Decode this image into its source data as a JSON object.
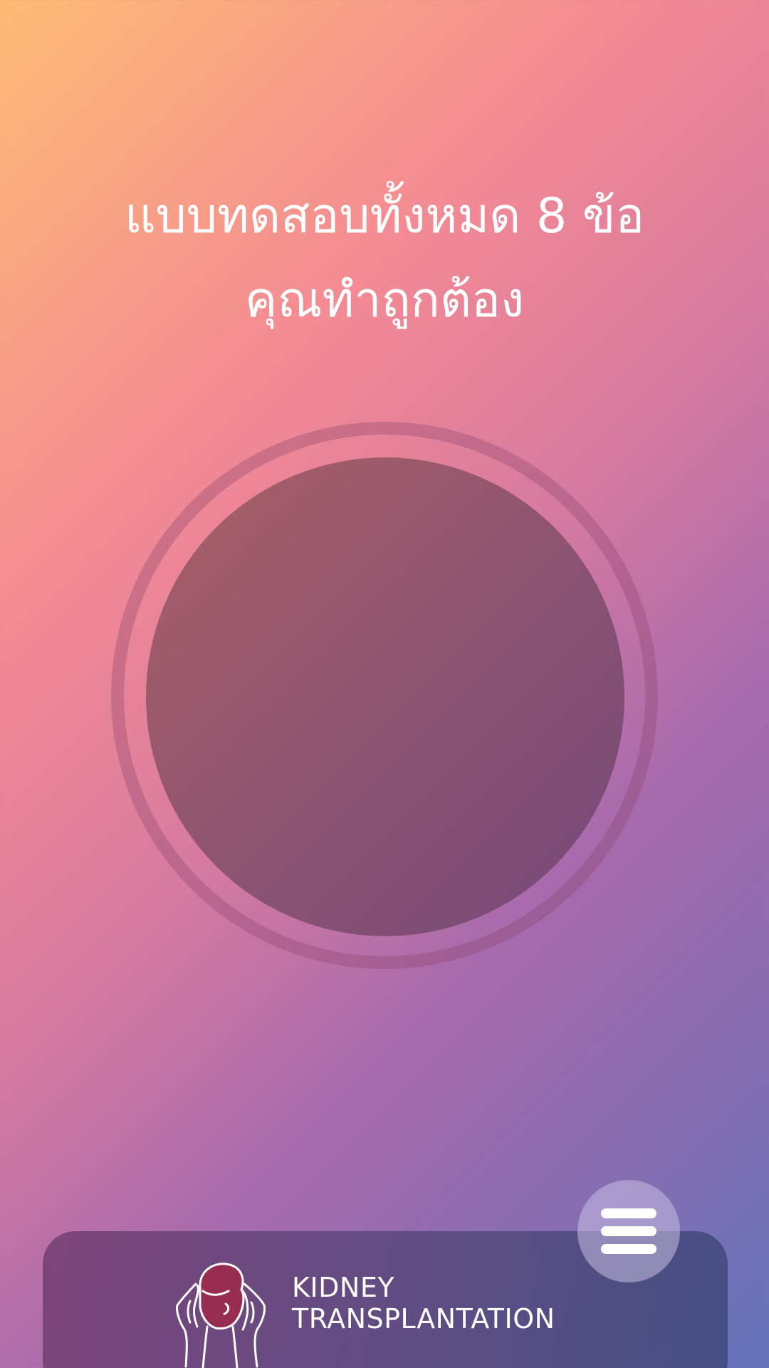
{
  "result": {
    "line1": "แบบทดสอบทั้งหมด 8 ข้อ",
    "line2": "คุณทำถูกต้อง",
    "score_circle_value": ""
  },
  "brand": {
    "line1": "KIDNEY",
    "line2": "TRANSPLANTATION",
    "logo_icon": "person-holding-head-icon",
    "logo_color": "#972e52"
  },
  "menu": {
    "icon": "hamburger-menu-icon"
  },
  "colors": {
    "gradient_start": "#fdbb74",
    "gradient_mid": "#f38a94",
    "gradient_mid2": "#a66aad",
    "gradient_end": "#6374ba",
    "circle_fill": "#8f5470",
    "text": "#ffffff"
  }
}
